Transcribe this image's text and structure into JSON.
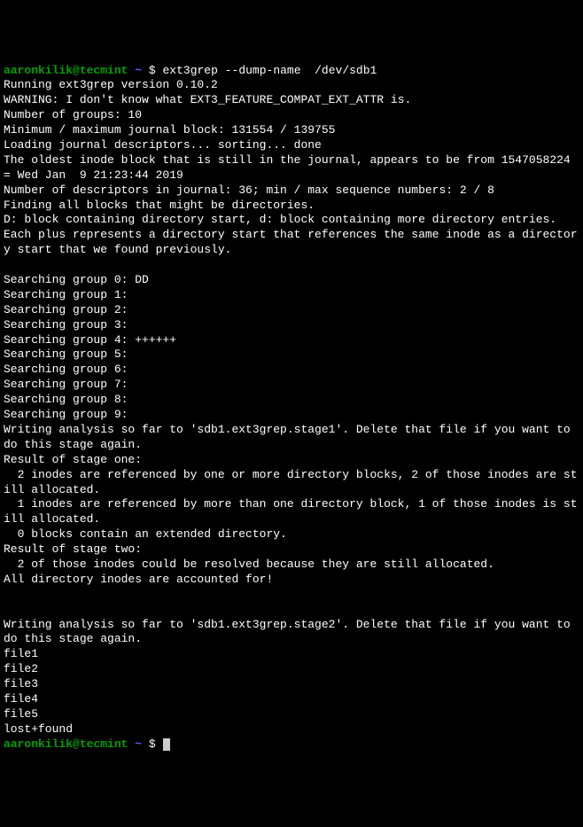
{
  "prompt": {
    "user": "aaronkilik@tecmint",
    "tilde": "~",
    "dollar": "$"
  },
  "command1": "ext3grep --dump-name  /dev/sdb1",
  "output_lines": [
    "Running ext3grep version 0.10.2",
    "WARNING: I don't know what EXT3_FEATURE_COMPAT_EXT_ATTR is.",
    "Number of groups: 10",
    "Minimum / maximum journal block: 131554 / 139755",
    "Loading journal descriptors... sorting... done",
    "The oldest inode block that is still in the journal, appears to be from 1547058224 = Wed Jan  9 21:23:44 2019",
    "Number of descriptors in journal: 36; min / max sequence numbers: 2 / 8",
    "Finding all blocks that might be directories.",
    "D: block containing directory start, d: block containing more directory entries.",
    "Each plus represents a directory start that references the same inode as a directory start that we found previously.",
    "",
    "Searching group 0: DD",
    "Searching group 1:",
    "Searching group 2:",
    "Searching group 3:",
    "Searching group 4: ++++++",
    "Searching group 5:",
    "Searching group 6:",
    "Searching group 7:",
    "Searching group 8:",
    "Searching group 9:",
    "Writing analysis so far to 'sdb1.ext3grep.stage1'. Delete that file if you want to do this stage again.",
    "Result of stage one:",
    "  2 inodes are referenced by one or more directory blocks, 2 of those inodes are still allocated.",
    "  1 inodes are referenced by more than one directory block, 1 of those inodes is still allocated.",
    "  0 blocks contain an extended directory.",
    "Result of stage two:",
    "  2 of those inodes could be resolved because they are still allocated.",
    "All directory inodes are accounted for!",
    "",
    "",
    "Writing analysis so far to 'sdb1.ext3grep.stage2'. Delete that file if you want to do this stage again.",
    "file1",
    "file2",
    "file3",
    "file4",
    "file5",
    "lost+found"
  ]
}
